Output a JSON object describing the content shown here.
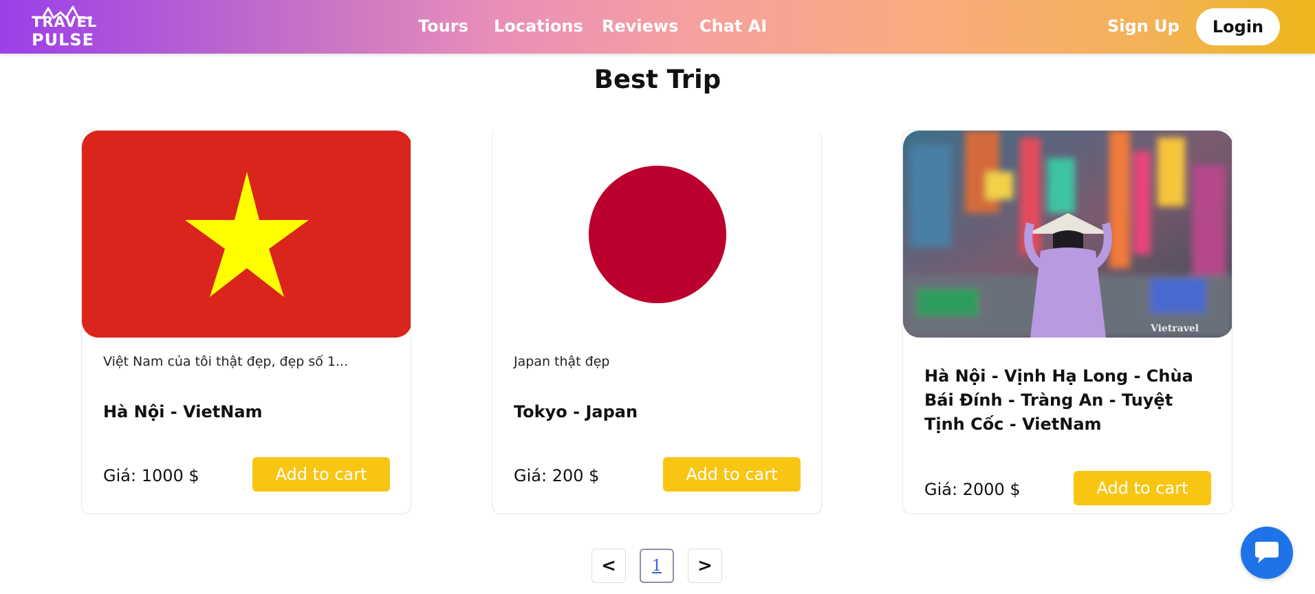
{
  "brand": {
    "logo_top": "TRAVEL",
    "logo_bottom": "PULSE",
    "gradient_start": "#9b3fe8",
    "gradient_end": "#eeb61a"
  },
  "nav": {
    "links": [
      "Tours",
      "Locations",
      "Reviews",
      "Chat AI"
    ],
    "signup_label": "Sign Up",
    "login_label": "Login"
  },
  "section": {
    "title": "Best Trip"
  },
  "cards": [
    {
      "image": "vietnam-flag",
      "description": "Việt Nam của tôi thật đẹp, đẹp số 1...",
      "name": "Hà Nội - VietNam",
      "price": "Giá: 1000 $",
      "button": "Add to cart"
    },
    {
      "image": "japan-flag",
      "description": "Japan thật đẹp",
      "name": "Tokyo - Japan",
      "price": "Giá: 200 $",
      "button": "Add to cart"
    },
    {
      "image": "city-street-photo",
      "watermark": "Vietravel",
      "description": "",
      "name": "Hà Nội - Vịnh Hạ Long - Chùa Bái Đính - Tràng An - Tuyệt Tịnh Cốc - VietNam",
      "price": "Giá: 2000 $",
      "button": "Add to cart"
    }
  ],
  "pagination": {
    "prev": "<",
    "current": "1",
    "next": ">"
  },
  "chat_fab": {
    "icon": "chat-bubble-icon",
    "color": "#1e73e8"
  },
  "colors": {
    "button": "#f9c513",
    "vietnam_red": "#da251d",
    "vietnam_star": "#ffff00",
    "japan_red": "#bc002d"
  }
}
